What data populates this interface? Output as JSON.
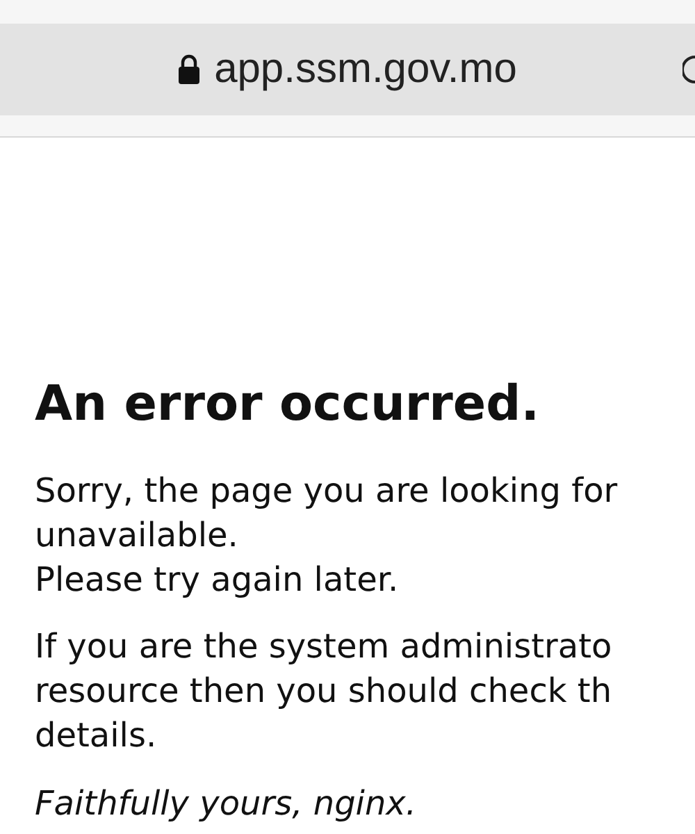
{
  "browser": {
    "url": "app.ssm.gov.mo",
    "secure": true
  },
  "page": {
    "heading": "An error occurred.",
    "paragraphs": [
      {
        "lines": [
          "Sorry, the page you are looking for",
          "unavailable.",
          "Please try again later."
        ]
      },
      {
        "lines": [
          "If you are the system administrato",
          "resource then you should check th",
          "details."
        ]
      }
    ],
    "signature": "Faithfully yours, nginx."
  }
}
